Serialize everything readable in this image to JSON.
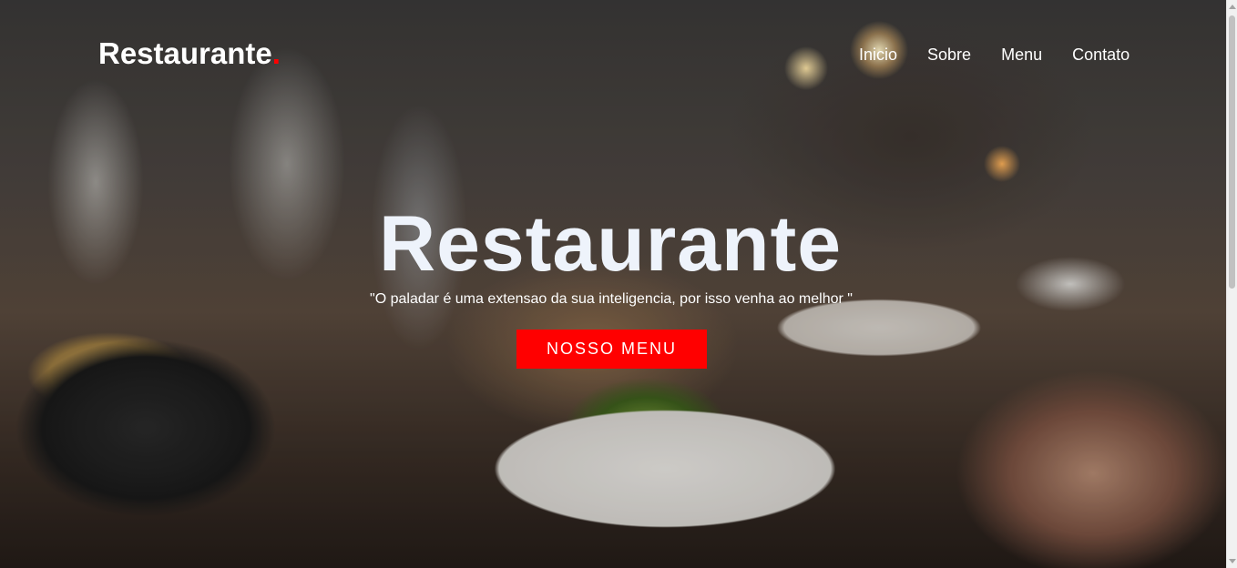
{
  "navbar": {
    "brand": "Restaurante",
    "brand_dot": ".",
    "links": [
      {
        "label": "Inicio"
      },
      {
        "label": "Sobre"
      },
      {
        "label": "Menu"
      },
      {
        "label": "Contato"
      }
    ]
  },
  "hero": {
    "title": "Restaurante",
    "subtitle": "\"O paladar é uma extensao da sua inteligencia, por isso venha ao melhor \"",
    "cta_label": "NOSSO MENU"
  },
  "colors": {
    "accent": "#ff0000",
    "text": "#ffffff"
  }
}
